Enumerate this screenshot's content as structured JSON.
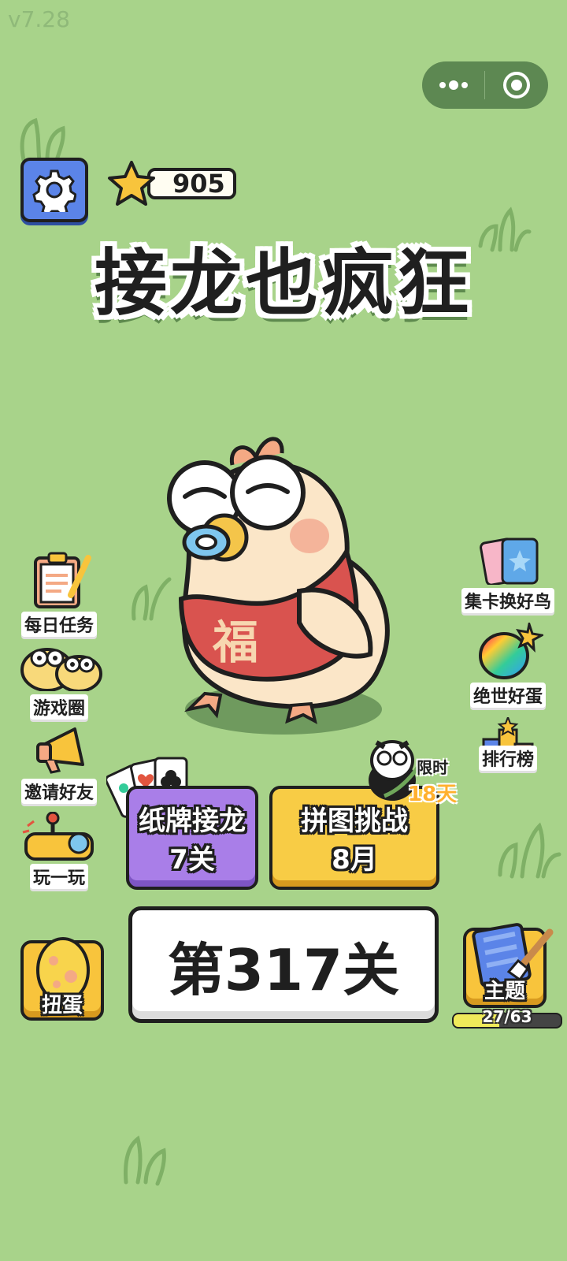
{
  "version": "v7.28",
  "top_bar": {
    "star_count": "905"
  },
  "title": "接龙也疯狂",
  "left_menu": [
    {
      "label": "每日任务",
      "icon": "clipboard-icon"
    },
    {
      "label": "游戏圈",
      "icon": "birds-group-icon"
    },
    {
      "label": "邀请好友",
      "icon": "megaphone-icon"
    },
    {
      "label": "玩一玩",
      "icon": "joystick-icon"
    }
  ],
  "right_menu": [
    {
      "label": "集卡换好鸟",
      "icon": "cards-icon"
    },
    {
      "label": "绝世好蛋",
      "icon": "rainbow-egg-icon"
    },
    {
      "label": "排行榜",
      "icon": "leaderboard-icon"
    }
  ],
  "mascot": {
    "shirt_text": "福"
  },
  "modes": {
    "solitaire": {
      "line1": "纸牌接龙",
      "line2": "7关"
    },
    "puzzle": {
      "line1": "拼图挑战",
      "line2": "8月"
    },
    "promo": {
      "line1": "限时",
      "line2": "18天"
    }
  },
  "level_button": "第317关",
  "gacha_button": "扭蛋",
  "theme_button": {
    "label": "主题",
    "progress_text": "27/63",
    "progress_fraction": 0.43
  },
  "colors": {
    "background": "#a8d38a",
    "purple": "#a97ee8",
    "yellow": "#f8cc45",
    "gear_blue": "#5b84e8"
  }
}
